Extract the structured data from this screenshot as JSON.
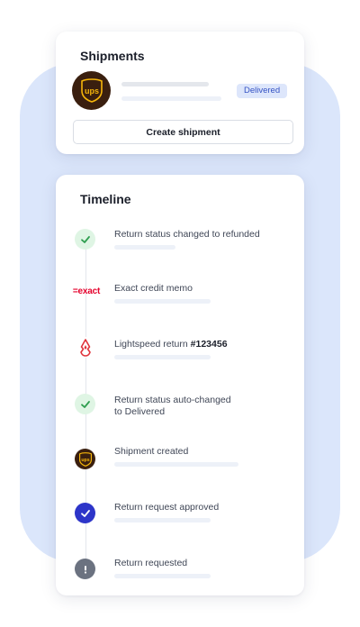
{
  "shipments": {
    "title": "Shipments",
    "carrier_icon": "ups-logo-icon",
    "carrier_logo_text": "ups",
    "status_badge": "Delivered",
    "create_button": "Create shipment"
  },
  "timeline": {
    "title": "Timeline",
    "items": [
      {
        "icon": "check-icon",
        "text": "Return status changed to refunded"
      },
      {
        "icon": "exact-logo-icon",
        "logo_text": "=exact",
        "text": "Exact credit memo"
      },
      {
        "icon": "lightspeed-logo-icon",
        "text": "Lightspeed return ",
        "text_bold": "#123456"
      },
      {
        "icon": "check-icon",
        "text_line1": "Return status auto-changed",
        "text_line2": "to Delivered"
      },
      {
        "icon": "ups-logo-icon",
        "logo_text": "ups",
        "text": "Shipment created"
      },
      {
        "icon": "check-circle-icon",
        "text": "Return request approved"
      },
      {
        "icon": "exclamation-icon",
        "text": "Return requested"
      }
    ]
  },
  "colors": {
    "background_blob": "#dbe6fb",
    "badge_bg": "#dde6fb",
    "badge_text": "#3553c4",
    "ups_brown": "#3a1f0f",
    "ups_gold": "#f5b50a",
    "check_green": "#2f9e4f",
    "approved_blue": "#2d35c9",
    "exact_red": "#e4002b",
    "lightspeed_red": "#e0343c"
  }
}
